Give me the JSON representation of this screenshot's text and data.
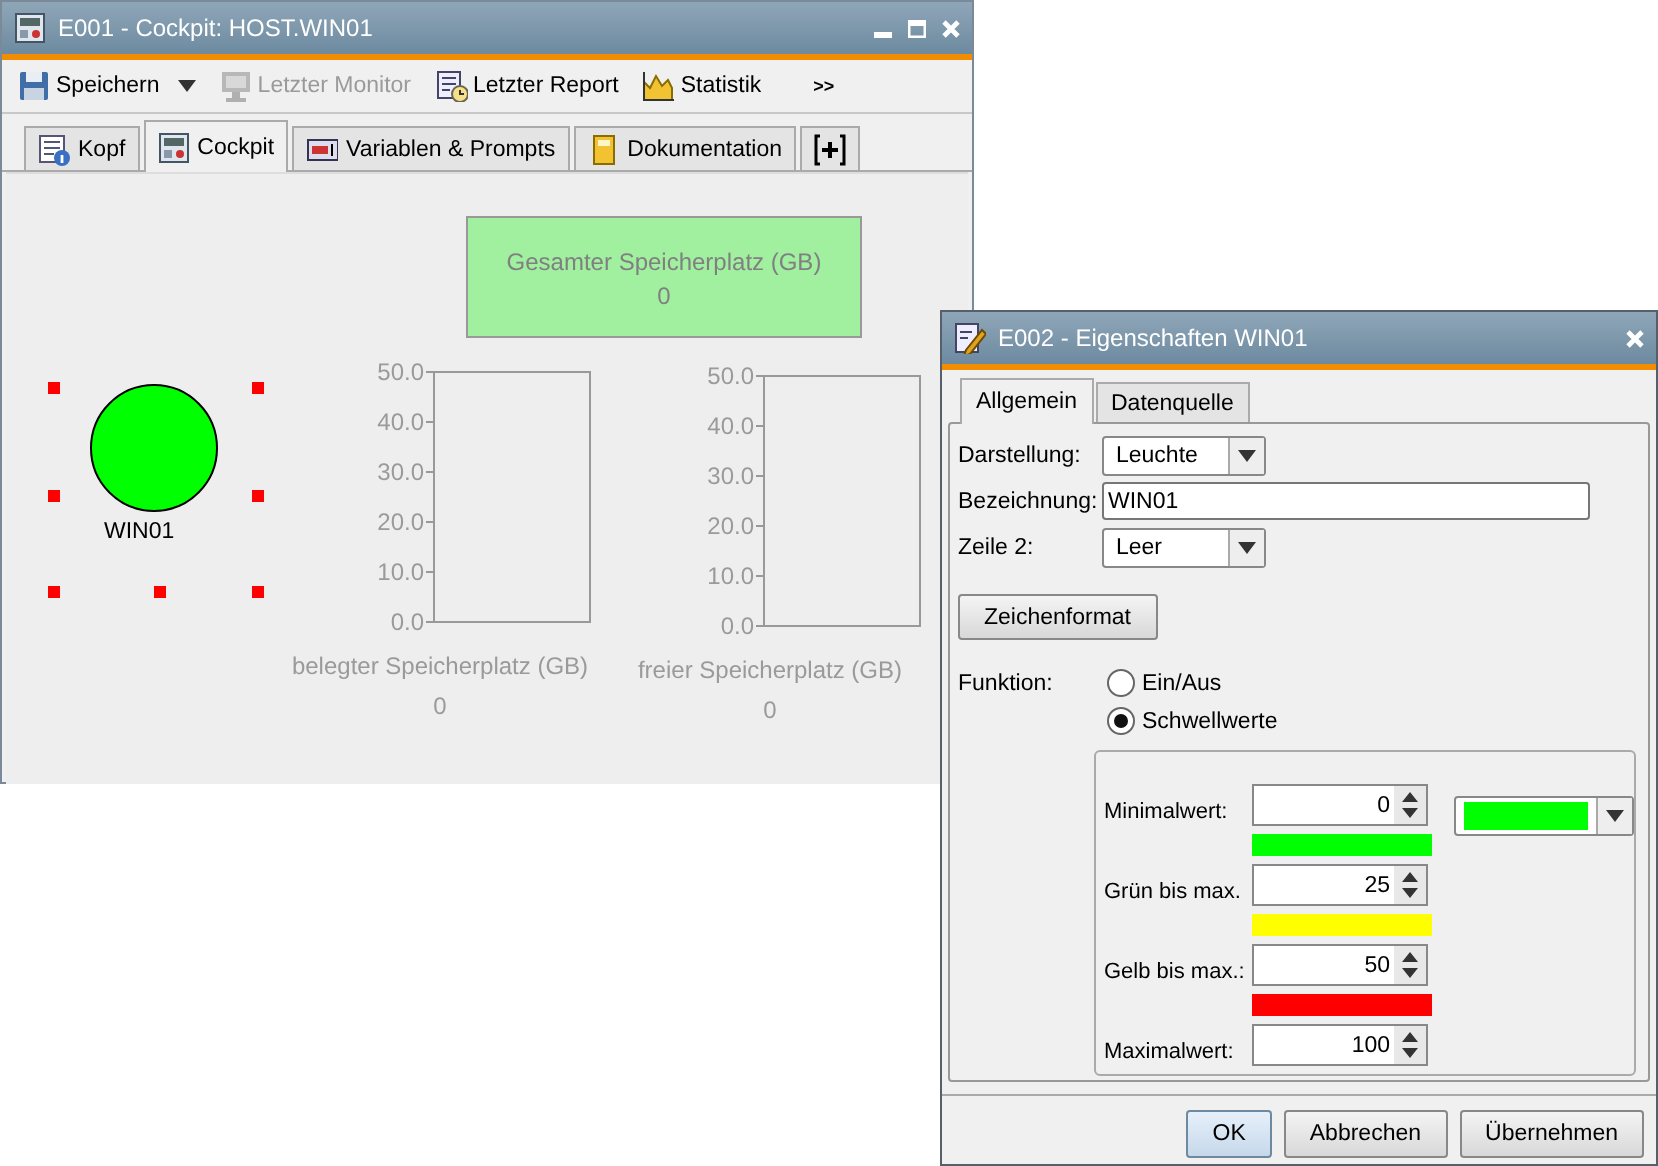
{
  "main_window": {
    "title": "E001 - Cockpit: HOST.WIN01",
    "toolbar": [
      {
        "label": "Speichern",
        "kind": "save",
        "disabled": false,
        "dropdown": true
      },
      {
        "label": "Letzter Monitor",
        "kind": "monitor",
        "disabled": true,
        "dropdown": false
      },
      {
        "label": "Letzter Report",
        "kind": "report",
        "disabled": false,
        "dropdown": false
      },
      {
        "label": "Statistik",
        "kind": "statistics",
        "disabled": false,
        "dropdown": false
      }
    ],
    "toolbar_overflow": ">>",
    "tabs": [
      {
        "label": "Kopf",
        "kind": "info",
        "selected": false
      },
      {
        "label": "Cockpit",
        "kind": "cockpit",
        "selected": true
      },
      {
        "label": "Variablen & Prompts",
        "kind": "variables",
        "selected": false
      },
      {
        "label": "Dokumentation",
        "kind": "docs",
        "selected": false
      },
      {
        "kind": "add",
        "selected": false
      }
    ],
    "canvas": {
      "lamp": {
        "label": "WIN01",
        "color": "#00ff00",
        "selected": true
      },
      "total": {
        "title": "Gesamter Speicherplatz (GB)",
        "value": "0"
      },
      "gauges": [
        {
          "title": "belegter Speicherplatz (GB)",
          "value": "0",
          "scale": [
            "50.0",
            "40.0",
            "30.0",
            "20.0",
            "10.0",
            "0.0"
          ]
        },
        {
          "title": "freier Speicherplatz (GB)",
          "value": "0",
          "scale": [
            "50.0",
            "40.0",
            "30.0",
            "20.0",
            "10.0",
            "0.0"
          ]
        }
      ]
    }
  },
  "dialog": {
    "title": "E002 - Eigenschaften WIN01",
    "tabs": [
      {
        "label": "Allgemein",
        "selected": true
      },
      {
        "label": "Datenquelle",
        "selected": false
      }
    ],
    "fields": [
      {
        "label": "Darstellung:",
        "kind": "dropdown",
        "value": "Leuchte"
      },
      {
        "label": "Bezeichnung:",
        "kind": "text",
        "value": "WIN01"
      },
      {
        "label": "Zeile 2:",
        "kind": "dropdown",
        "value": "Leer"
      }
    ],
    "format_button": "Zeichenformat",
    "function_label": "Funktion:",
    "function_options": [
      {
        "label": "Ein/Aus",
        "selected": false
      },
      {
        "label": "Schwellwerte",
        "selected": true
      }
    ],
    "thresholds": [
      {
        "label": "Minimalwert:",
        "value": "0",
        "color": "#00ff00"
      },
      {
        "label": "Grün bis max.",
        "value": "25",
        "color": "#ffff00"
      },
      {
        "label": "Gelb bis max.:",
        "value": "50",
        "color": "#ff0000"
      },
      {
        "label": "Maximalwert:",
        "value": "100"
      }
    ],
    "color_choice": {
      "color": "#00ff00"
    },
    "buttons": [
      {
        "label": "OK",
        "default": true
      },
      {
        "label": "Abbrechen",
        "default": false
      },
      {
        "label": "Übernehmen",
        "default": false
      }
    ]
  }
}
